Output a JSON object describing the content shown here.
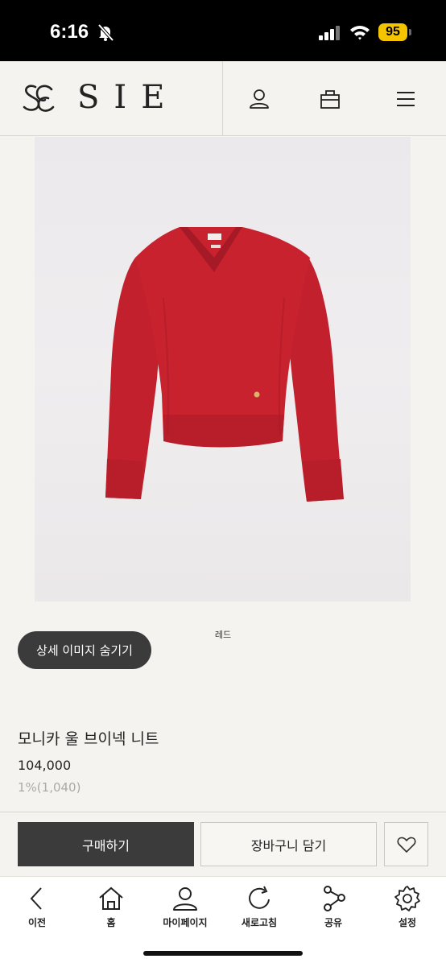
{
  "status_bar": {
    "time": "6:16",
    "battery": "95"
  },
  "header": {
    "logo_text": "SIE",
    "icons": [
      "user-icon",
      "bag-icon",
      "menu-icon"
    ]
  },
  "product": {
    "color_label": "레드",
    "hide_images_label": "상세 이미지 숨기기",
    "name": "모니카 울 브이넥 니트",
    "price": "104,000",
    "points": "1%(1,040)",
    "sweater_color": "#c3202e"
  },
  "actions": {
    "buy_label": "구매하기",
    "cart_label": "장바구니 담기"
  },
  "bottom_nav": {
    "items": [
      {
        "label": "이전",
        "icon": "back-icon"
      },
      {
        "label": "홈",
        "icon": "home-icon"
      },
      {
        "label": "마이페이지",
        "icon": "user-icon"
      },
      {
        "label": "새로고침",
        "icon": "refresh-icon"
      },
      {
        "label": "공유",
        "icon": "share-icon"
      },
      {
        "label": "설정",
        "icon": "gear-icon"
      }
    ]
  }
}
